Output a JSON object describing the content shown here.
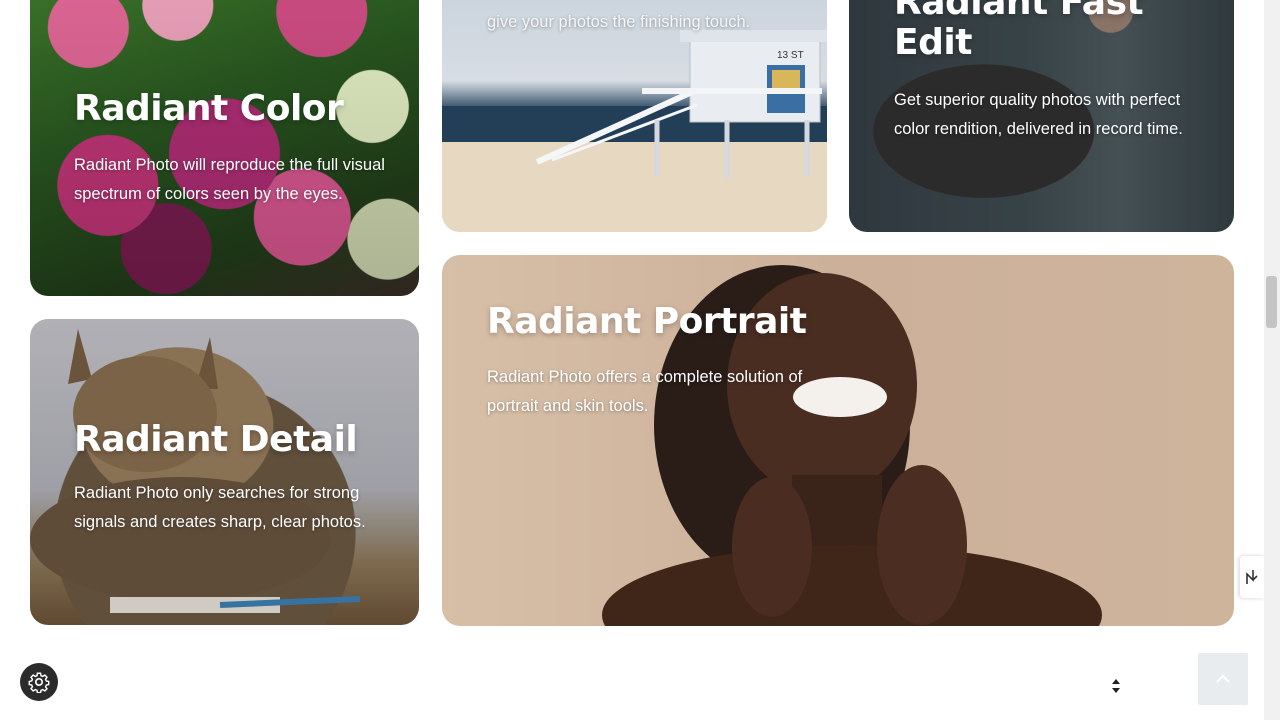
{
  "cards": {
    "color": {
      "title": "Radiant Color",
      "text": "Radiant Photo will reproduce the full visual spectrum of colors seen by the eyes."
    },
    "beach": {
      "text": "give your photos the finishing touch.",
      "tower_sign": "13 ST"
    },
    "fast_edit": {
      "title_line1": "Radiant Fast",
      "title_line2": "Edit",
      "text": "Get superior quality photos with perfect color rendition, delivered in record time."
    },
    "detail": {
      "title": "Radiant Detail",
      "text": "Radiant Photo only searches for strong signals and creates sharp, clear photos."
    },
    "portrait": {
      "title": "Radiant Portrait",
      "text": "Radiant Photo offers a complete solution of portrait and skin tools."
    }
  },
  "icons": {
    "settings": "gear-icon",
    "back_to_top": "chevron-up-icon",
    "scroll": "scroll-arrows-icon",
    "side_tab": "wave-icon"
  },
  "colors": {
    "settings_button": "#2b2b2b",
    "top_button": "#e9ecef"
  }
}
